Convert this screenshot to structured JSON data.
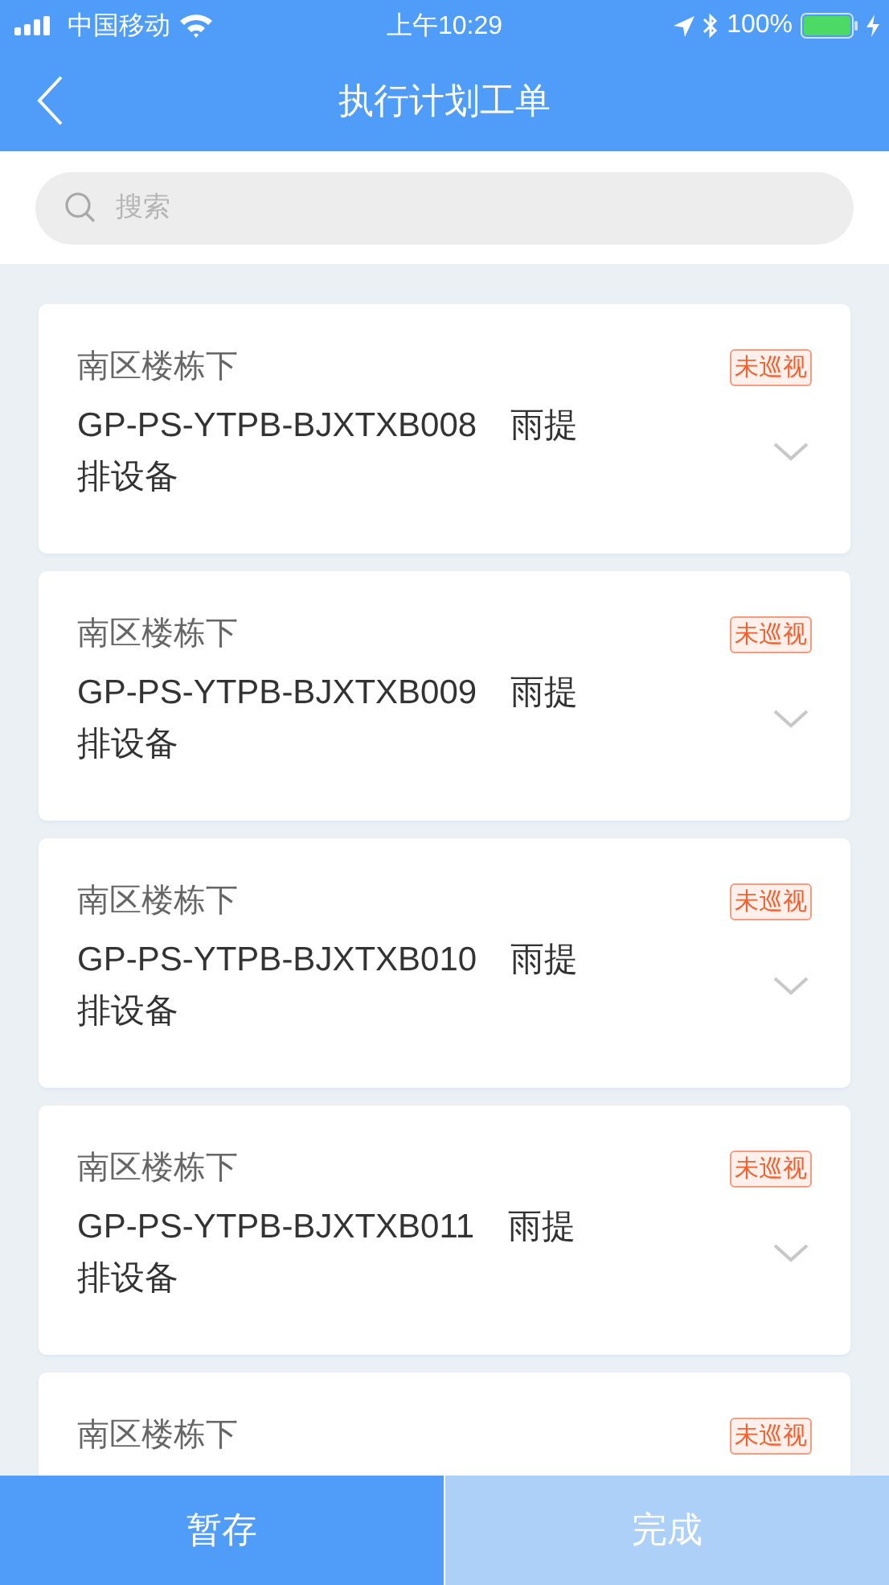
{
  "status_bar": {
    "carrier": "中国移动",
    "time": "上午10:29",
    "battery": "100%"
  },
  "nav": {
    "title": "执行计划工单"
  },
  "search": {
    "placeholder": "搜索"
  },
  "orders": [
    {
      "location": "南区楼栋下",
      "code": "GP-PS-YTPB-BJXTXB008　雨提排设备",
      "status": "未巡视",
      "expanded": false
    },
    {
      "location": "南区楼栋下",
      "code": "GP-PS-YTPB-BJXTXB009　雨提排设备",
      "status": "未巡视",
      "expanded": false
    },
    {
      "location": "南区楼栋下",
      "code": "GP-PS-YTPB-BJXTXB010　雨提排设备",
      "status": "未巡视",
      "expanded": false
    },
    {
      "location": "南区楼栋下",
      "code": "GP-PS-YTPB-BJXTXB011　雨提排设备",
      "status": "未巡视",
      "expanded": false
    },
    {
      "location": "南区楼栋下",
      "status": "未巡视"
    }
  ],
  "buttons": [
    {
      "label": "暂存",
      "disabled": false
    },
    {
      "label": "完成",
      "disabled": true
    }
  ]
}
